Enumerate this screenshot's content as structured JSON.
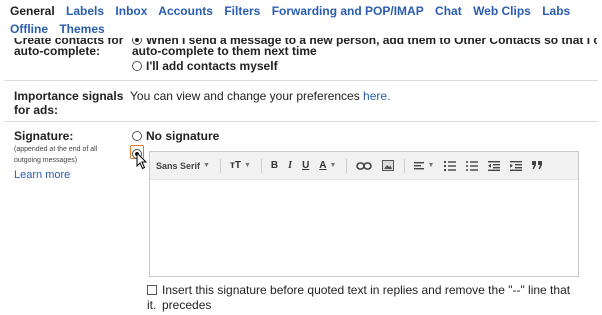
{
  "tabs": [
    "General",
    "Labels",
    "Inbox",
    "Accounts",
    "Filters",
    "Forwarding and POP/IMAP",
    "Chat",
    "Web Clips",
    "Labs",
    "Offline",
    "Themes"
  ],
  "active_tab": "General",
  "autocomplete": {
    "label_top": "Create contacts for",
    "label": "auto-complete:",
    "option1_line1": "When I send a message to a new person, add them to Other Contacts so that I can",
    "option1_line2": "auto-complete to them next time",
    "option2": "I'll add contacts myself"
  },
  "importance": {
    "label_line1": "Importance signals",
    "label_line2": "for ads:",
    "text": "You can view and change your preferences ",
    "link": "here."
  },
  "signature": {
    "label": "Signature:",
    "note_line1": "(appended at the end of all",
    "note_line2": "outgoing messages)",
    "learn_more": "Learn more",
    "no_signature": "No signature",
    "toolbar": {
      "font": "Sans Serif",
      "size": "тT",
      "bold": "B",
      "italic": "I",
      "underline": "U",
      "text_color": "A"
    },
    "insert_line1": "Insert this signature before quoted text in replies and remove the \"--\" line that precedes",
    "insert_line2": "it."
  },
  "colors": {
    "link": "#2a5db0",
    "text": "#222222",
    "toolbar_bg": "#f1f1f1"
  }
}
